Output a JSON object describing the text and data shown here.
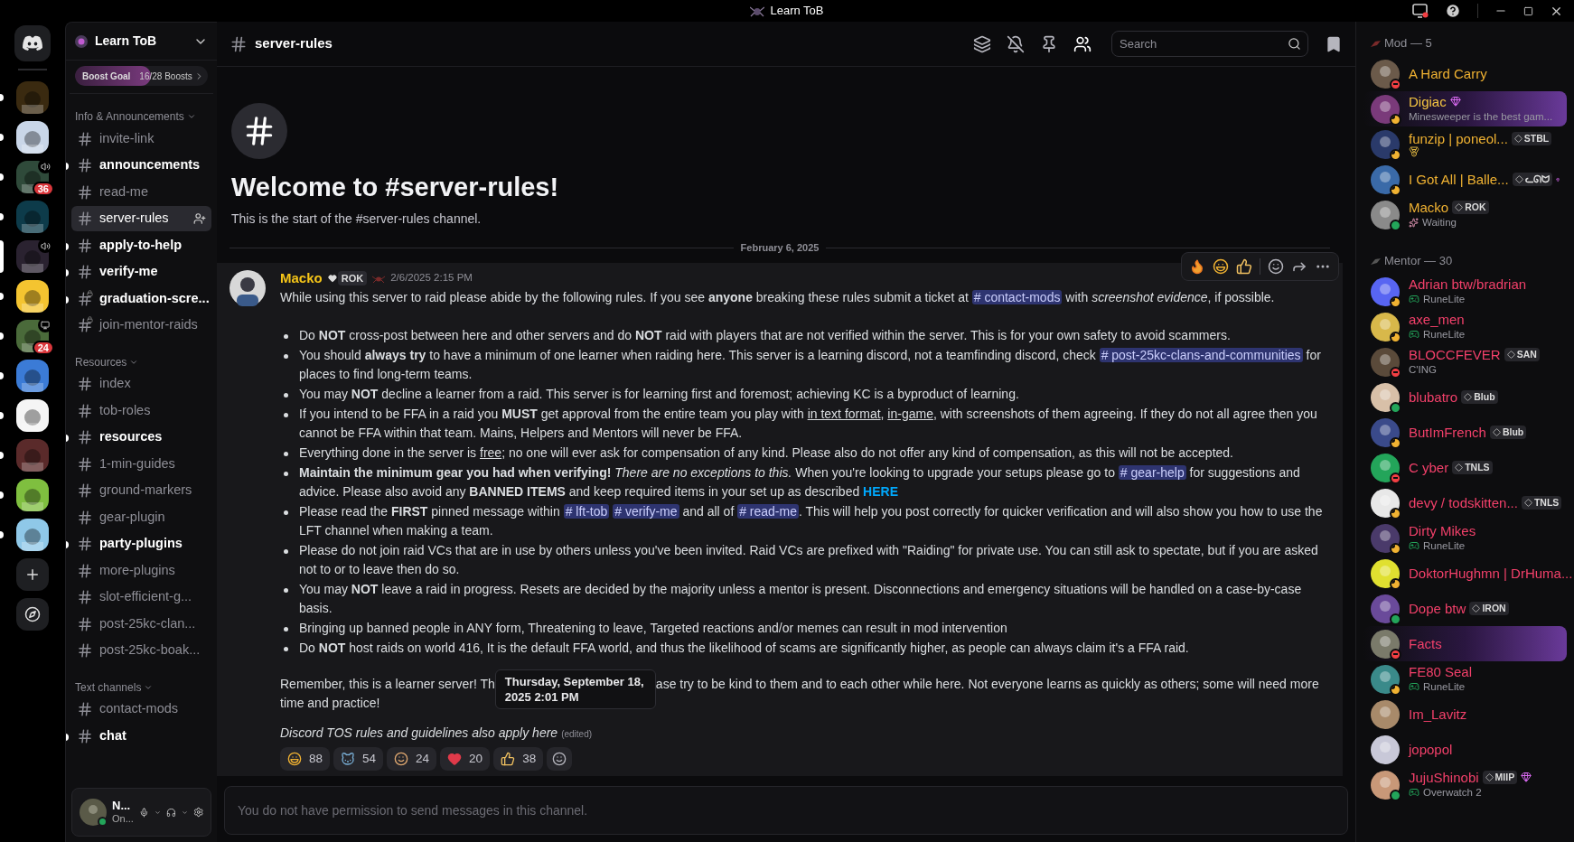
{
  "title_bar": {
    "title": "Learn ToB"
  },
  "servers": [
    {
      "unread": true,
      "selected": false
    },
    {
      "unread": true,
      "selected": false
    },
    {
      "unread": true,
      "selected": false,
      "voice": true,
      "badge": "36"
    },
    {
      "unread": true,
      "selected": false
    },
    {
      "selected": true,
      "voice": true
    },
    {
      "unread": true,
      "selected": false
    },
    {
      "unread": true,
      "selected": false,
      "screen": true,
      "badge": "24"
    },
    {
      "unread": true,
      "selected": false
    },
    {
      "unread": true,
      "selected": false
    },
    {
      "unread": true,
      "selected": false
    },
    {
      "unread": true,
      "selected": false
    },
    {
      "unread": true,
      "selected": false
    }
  ],
  "server": {
    "name": "Learn ToB",
    "boost": {
      "label": "Boost Goal",
      "count": "16/28 Boosts",
      "level": 0.571
    }
  },
  "categories": [
    {
      "name": "Info & Announcements",
      "channels": [
        {
          "name": "invite-link",
          "unread": false,
          "selected": false,
          "locked": false
        },
        {
          "name": "announcements",
          "unread": true,
          "selected": false,
          "locked": false
        },
        {
          "name": "read-me",
          "unread": false,
          "selected": false,
          "locked": false
        },
        {
          "name": "server-rules",
          "unread": false,
          "selected": true,
          "locked": false
        },
        {
          "name": "apply-to-help",
          "unread": true,
          "selected": false,
          "locked": false
        },
        {
          "name": "verify-me",
          "unread": true,
          "selected": false,
          "locked": false
        },
        {
          "name": "graduation-scre...",
          "unread": true,
          "selected": false,
          "locked": true
        },
        {
          "name": "join-mentor-raids",
          "unread": false,
          "selected": false,
          "locked": true
        }
      ]
    },
    {
      "name": "Resources",
      "channels": [
        {
          "name": "index",
          "unread": false,
          "selected": false,
          "locked": false
        },
        {
          "name": "tob-roles",
          "unread": false,
          "selected": false,
          "locked": false
        },
        {
          "name": "resources",
          "unread": true,
          "selected": false,
          "locked": false
        },
        {
          "name": "1-min-guides",
          "unread": false,
          "selected": false,
          "locked": false
        },
        {
          "name": "ground-markers",
          "unread": false,
          "selected": false,
          "locked": false
        },
        {
          "name": "gear-plugin",
          "unread": false,
          "selected": false,
          "locked": false
        },
        {
          "name": "party-plugins",
          "unread": true,
          "selected": false,
          "locked": false
        },
        {
          "name": "more-plugins",
          "unread": false,
          "selected": false,
          "locked": false
        },
        {
          "name": "slot-efficient-g...",
          "unread": false,
          "selected": false,
          "locked": false
        },
        {
          "name": "post-25kc-clan...",
          "unread": false,
          "selected": false,
          "locked": false
        },
        {
          "name": "post-25kc-boak...",
          "unread": false,
          "selected": false,
          "locked": false
        }
      ]
    },
    {
      "name": "Text channels",
      "channels": [
        {
          "name": "contact-mods",
          "unread": false,
          "selected": false,
          "locked": false
        },
        {
          "name": "chat",
          "unread": true,
          "selected": false,
          "locked": false
        }
      ]
    }
  ],
  "user_panel": {
    "name": "N...",
    "status": "On..."
  },
  "header": {
    "channel": "server-rules",
    "search": {
      "placeholder": "Search"
    }
  },
  "welcome": {
    "title": "Welcome to #server-rules!",
    "subtitle": "This is the start of the #server-rules channel."
  },
  "date_divider": "February 6, 2025",
  "message": {
    "author": "Macko",
    "tag": "ROK",
    "time": "2/6/2025 2:15 PM",
    "intro": [
      {
        "kind": "text",
        "text": "While using this server to raid please abide by the following rules. If you see **anyone** breaking these rules submit a ticket at "
      },
      {
        "kind": "mention",
        "text": "# contact-mods"
      },
      {
        "kind": "text",
        "text": " with *screenshot evidence*, if possible."
      }
    ],
    "rules": [
      [
        {
          "kind": "text",
          "text": "Do **NOT** cross-post between here and other servers and do **NOT** raid with players that are not verified within the server. This is for your own safety to avoid scammers."
        }
      ],
      [
        {
          "kind": "text",
          "text": "You should **always try** to have a minimum of one learner when raiding here. This server is a learning discord, not a teamfinding discord, check "
        },
        {
          "kind": "mention",
          "text": "# post-25kc-clans-and-communities"
        },
        {
          "kind": "text",
          "text": " for places to find long-term teams."
        }
      ],
      [
        {
          "kind": "text",
          "text": "You may **NOT** decline a learner from a raid. This server is for learning first and foremost; achieving KC is a byproduct of learning."
        }
      ],
      [
        {
          "kind": "text",
          "text": "If you intend to be FFA in a raid you **MUST** get approval from the entire team you play with "
        },
        {
          "kind": "underline",
          "text": "in text format"
        },
        {
          "kind": "text",
          "text": ", "
        },
        {
          "kind": "underline",
          "text": "in-game"
        },
        {
          "kind": "text",
          "text": ", with screenshots of them agreeing. If they do not all agree then you cannot be FFA within that team. Mains, Helpers and Mentors will never be FFA."
        }
      ],
      [
        {
          "kind": "text",
          "text": "Everything done in the server is "
        },
        {
          "kind": "underline",
          "text": "free"
        },
        {
          "kind": "text",
          "text": "; no one will ever ask for compensation of any kind. Please also do not offer any kind of compensation, as this will not be accepted."
        }
      ],
      [
        {
          "kind": "text",
          "text": "**Maintain the minimum gear you had when verifying!** *There are no exceptions to this.* When you're looking to upgrade your setups please go to "
        },
        {
          "kind": "mention",
          "text": "# gear-help"
        },
        {
          "kind": "text",
          "text": " for suggestions and advice. Please also avoid any **BANNED ITEMS** and keep required items in your set up as described "
        },
        {
          "kind": "link",
          "text": "HERE"
        }
      ],
      [
        {
          "kind": "text",
          "text": "Please read the **FIRST** pinned message within "
        },
        {
          "kind": "mention",
          "text": "# lft-tob"
        },
        {
          "kind": "mention",
          "text": "# verify-me"
        },
        {
          "kind": "text",
          "text": " and all of "
        },
        {
          "kind": "mention",
          "text": "# read-me"
        },
        {
          "kind": "text",
          "text": ".  This will help you post correctly for quicker verification and will also show you how to use the LFT channel when making a team."
        }
      ],
      [
        {
          "kind": "text",
          "text": "Please do not join raid VCs that are in use by others unless you've been invited. Raid VCs are prefixed with \"Raiding\" for private use. You can still ask to spectate, but if you are asked not to or to leave then do so."
        }
      ],
      [
        {
          "kind": "text",
          "text": "You may **NOT** leave a raid in progress. Resets are decided by the majority unless a mentor is present. Disconnections and emergency situations will be handled on a case-by-case basis."
        }
      ],
      [
        {
          "kind": "text",
          "text": "Bringing up banned people in ANY form, Threatening to leave, Targeted reactions and/or memes can result in mod intervention"
        }
      ],
      [
        {
          "kind": "text",
          "text": "Do **NOT** host raids on world 416, It is the default FFA world, and thus the likelihood of scams are significantly higher, as people can always claim it's a FFA raid."
        }
      ]
    ],
    "closing_before": "Remember, this is a learner server! Th",
    "closing_after": "ase try to be kind to them and to each other while here. Not everyone learns as quickly as others; some will need more time and practice!",
    "footer": "Discord TOS rules and guidelines also apply here",
    "edited": "(edited)",
    "reactions": [
      {
        "count": "88"
      },
      {
        "count": "54"
      },
      {
        "count": "24"
      },
      {
        "count": "20"
      },
      {
        "count": "38"
      }
    ]
  },
  "tooltip": {
    "lines": [
      "Thursday, September 18,",
      "2025 2:01 PM"
    ]
  },
  "composer": {
    "notice": "You do not have permission to send messages in this channel."
  },
  "member_groups": [
    {
      "title": "Mod — 5",
      "members": [
        {
          "name": "A Hard Carry",
          "color": "#f0b232",
          "status": {
            "kind": "dnd"
          }
        },
        {
          "name": "Digiac",
          "color": "#f5c542",
          "status": {
            "kind": "idle"
          },
          "boost": true,
          "nameplate": true,
          "activity": {
            "kind": "status",
            "text": "Minesweeper is the best gam..."
          }
        },
        {
          "name": "funzip | poneol...",
          "color": "#f0b232",
          "status": {
            "kind": "idle"
          },
          "tag": "STBL",
          "activity": {
            "kind": "emoji"
          }
        },
        {
          "name": "I Got All | Balle...",
          "color": "#f0b232",
          "status": {
            "kind": "idle"
          },
          "tag": "ᓚᘏᗢ",
          "boost": true
        },
        {
          "name": "Macko",
          "color": "#f0b232",
          "status": {
            "kind": "online"
          },
          "tag": "ROK",
          "activity": {
            "kind": "emoji-status",
            "text": "Waiting"
          }
        }
      ]
    },
    {
      "title": "Mentor — 30",
      "members": [
        {
          "name": "Adrian btw/bradrian",
          "color": "#f2406a",
          "status": {
            "kind": "idle"
          },
          "activity": {
            "kind": "game",
            "text": "RuneLite"
          }
        },
        {
          "name": "axe_men",
          "color": "#f2406a",
          "status": {
            "kind": "idle"
          },
          "activity": {
            "kind": "game",
            "text": "RuneLite"
          }
        },
        {
          "name": "BLOCCFEVER",
          "color": "#f2406a",
          "status": {
            "kind": "dnd"
          },
          "tag": "SAN",
          "activity": {
            "kind": "status",
            "text": "C'ING"
          }
        },
        {
          "name": "blubatro",
          "color": "#f2406a",
          "status": {
            "kind": "online"
          },
          "tag": "Blub"
        },
        {
          "name": "ButImFrench",
          "color": "#f2406a",
          "status": {
            "kind": "idle"
          },
          "tag": "Blub"
        },
        {
          "name": "C yber",
          "color": "#f2406a",
          "status": {
            "kind": "dnd"
          },
          "tag": "TNLS"
        },
        {
          "name": "devy / todskitten...",
          "color": "#f2406a",
          "status": {
            "kind": "idle"
          },
          "tag": "TNLS"
        },
        {
          "name": "Dirty Mikes",
          "color": "#f2406a",
          "status": {
            "kind": "idle"
          },
          "activity": {
            "kind": "game",
            "text": "RuneLite"
          }
        },
        {
          "name": "DoktorHughmn | DrHuma...",
          "color": "#f2406a",
          "status": {
            "kind": "idle"
          }
        },
        {
          "name": "Dope btw",
          "color": "#f2406a",
          "status": {
            "kind": "online"
          },
          "tag": "IRON"
        },
        {
          "name": "Facts",
          "color": "#f2406a",
          "status": {
            "kind": "dnd"
          },
          "nameplate": true
        },
        {
          "name": "FE80 Seal",
          "color": "#f2406a",
          "status": {
            "kind": "idle"
          },
          "activity": {
            "kind": "game",
            "text": "RuneLite"
          }
        },
        {
          "name": "Im_Lavitz",
          "color": "#f2406a"
        },
        {
          "name": "jopopol",
          "color": "#f2406a"
        },
        {
          "name": "JujuShinobi",
          "color": "#f2406a",
          "status": {
            "kind": "online"
          },
          "tag": "MIIP",
          "boost": true,
          "activity": {
            "kind": "game",
            "text": "Overwatch 2"
          }
        }
      ]
    }
  ]
}
